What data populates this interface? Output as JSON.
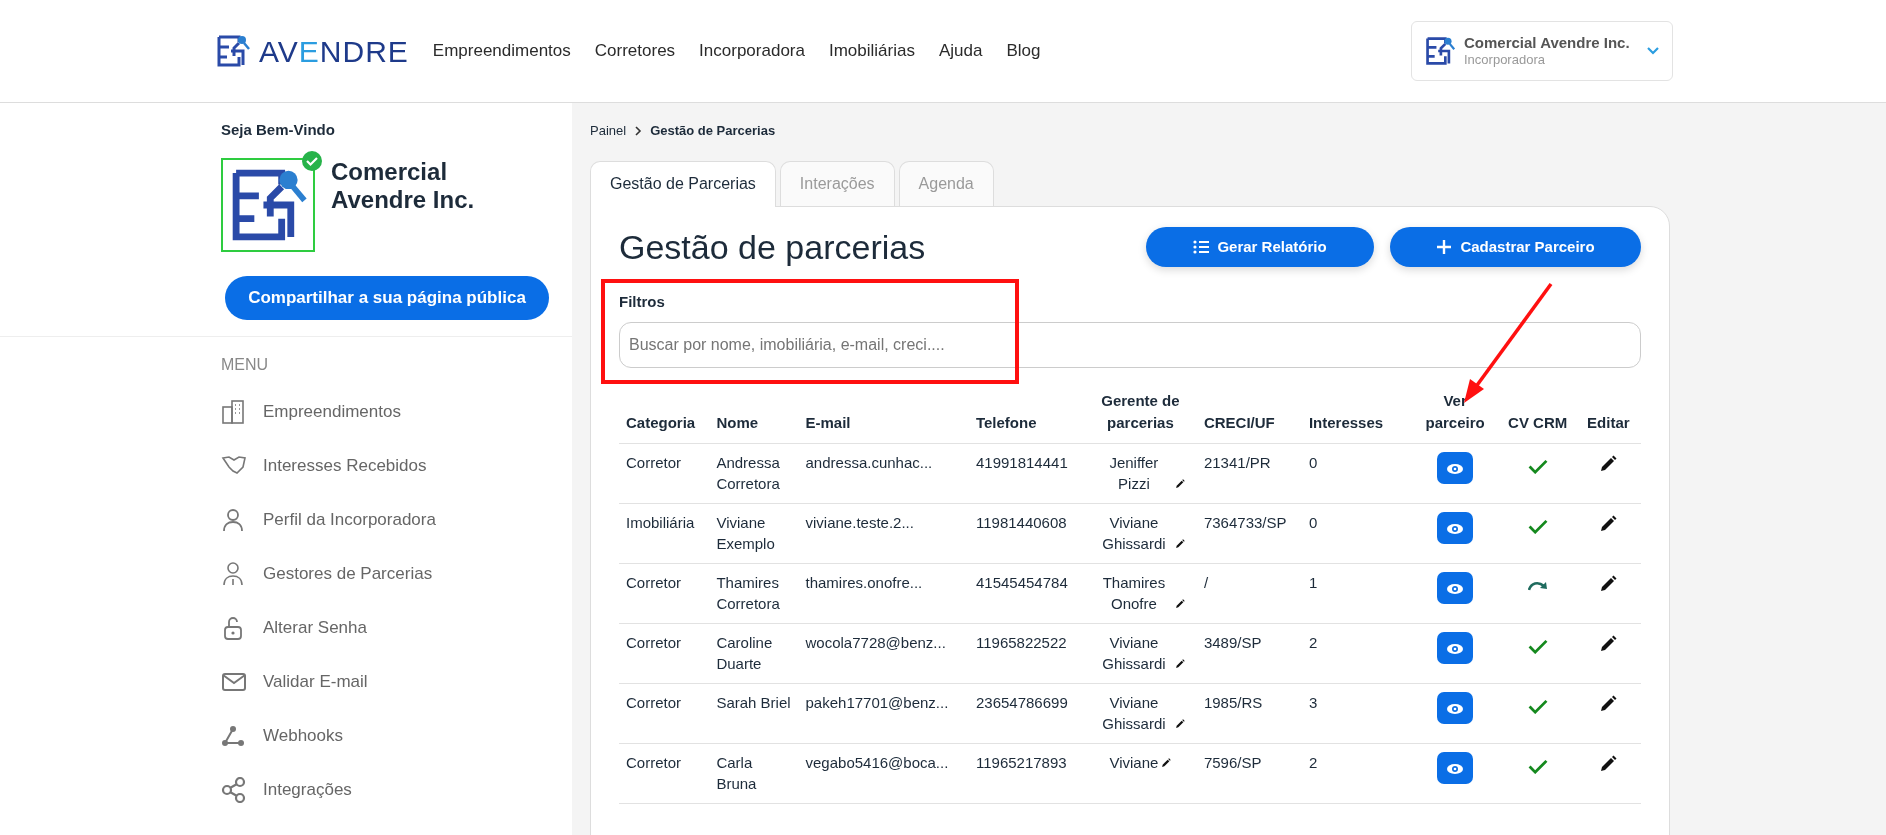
{
  "header": {
    "logo_parts": [
      {
        "text": "AV",
        "accent": false
      },
      {
        "text": "E",
        "accent": true
      },
      {
        "text": "NDRE",
        "accent": false
      }
    ],
    "nav": [
      "Empreendimentos",
      "Corretores",
      "Incorporadora",
      "Imobiliárias",
      "Ajuda",
      "Blog"
    ],
    "account": {
      "name": "Comercial Avendre Inc.",
      "role": "Incorporadora"
    }
  },
  "sidebar": {
    "welcome": "Seja Bem-Vindo",
    "verified": true,
    "company": "Comercial Avendre Inc.",
    "share_button": "Compartilhar a sua página pública",
    "menu_title": "MENU",
    "items": [
      "Empreendimentos",
      "Interesses Recebidos",
      "Perfil da Incorporadora",
      "Gestores de Parcerias",
      "Alterar Senha",
      "Validar E-mail",
      "Webhooks",
      "Integrações"
    ]
  },
  "breadcrumb": [
    "Painel",
    "Gestão de Parcerias"
  ],
  "tabs": [
    {
      "label": "Gestão de Parcerias",
      "selected": true
    },
    {
      "label": "Interações",
      "selected": false
    },
    {
      "label": "Agenda",
      "selected": false
    }
  ],
  "title": "Gestão de parcerias",
  "buttons": [
    {
      "kind": "list",
      "label": "Gerar Relatório"
    },
    {
      "kind": "add",
      "label": "Cadastrar Parceiro"
    }
  ],
  "filters": {
    "label": "Filtros",
    "placeholder": "Buscar por nome, imobiliária, e-mail, creci...."
  },
  "table": {
    "columns": [
      "Categoria",
      "Nome",
      "E-mail",
      "Telefone",
      "Gerente de parcerias",
      "CRECI/UF",
      "Interesses",
      "Ver parceiro",
      "CV CRM",
      "Editar"
    ],
    "rows": [
      {
        "categoria": "Corretor",
        "nome": "Andressa Corretora",
        "email": "andressa.cunhac...",
        "telefone": "41991814441",
        "gerente": "Jeniffer Pizzi",
        "creci": "21341/PR",
        "interesses": "0",
        "crm_synced": true
      },
      {
        "categoria": "Imobiliária",
        "nome": "Viviane Exemplo",
        "email": "viviane.teste.2...",
        "telefone": "11981440608",
        "gerente": "Viviane Ghissardi",
        "creci": "7364733/SP",
        "interesses": "0",
        "crm_synced": true
      },
      {
        "categoria": "Corretor",
        "nome": "Thamires Corretora",
        "email": "thamires.onofre...",
        "telefone": "41545454784",
        "gerente": "Thamires Onofre",
        "creci": "/",
        "interesses": "1",
        "crm_synced": false
      },
      {
        "categoria": "Corretor",
        "nome": "Caroline Duarte",
        "email": "wocola7728@benz...",
        "telefone": "11965822522",
        "gerente": "Viviane Ghissardi",
        "creci": "3489/SP",
        "interesses": "2",
        "crm_synced": true
      },
      {
        "categoria": "Corretor",
        "nome": "Sarah Briel",
        "email": "pakeh17701@benz...",
        "telefone": "23654786699",
        "gerente": "Viviane Ghissardi",
        "creci": "1985/RS",
        "interesses": "3",
        "crm_synced": true
      },
      {
        "categoria": "Corretor",
        "nome": "Carla Bruna",
        "email": "vegabo5416@boca...",
        "telefone": "11965217893",
        "gerente": "Viviane",
        "creci": "7596/SP",
        "interesses": "2",
        "crm_synced": true
      }
    ]
  }
}
